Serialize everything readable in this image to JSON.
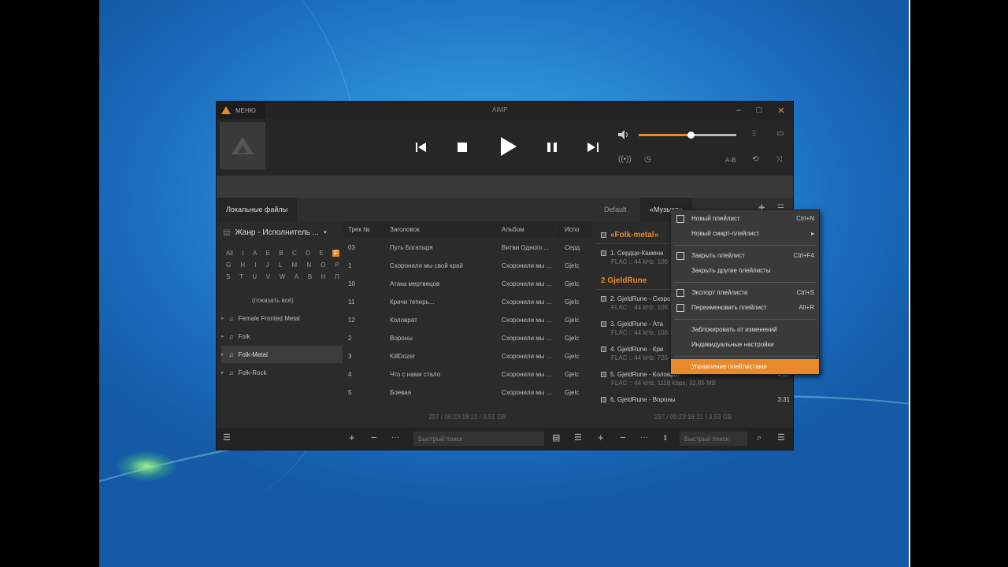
{
  "window": {
    "menu_label": "МЕНЮ",
    "title": "AIMP",
    "minimize": "–",
    "maximize": "□",
    "close": "✕"
  },
  "player": {
    "volume_percent": 53,
    "ab_label": "A-B"
  },
  "tabs": {
    "local": "Локальные файлы",
    "default": "Default",
    "music": "«Музыка»"
  },
  "library": {
    "grouping": "Жанр - Исполнитель ...",
    "alphabet_rows": [
      [
        "All",
        "I",
        "А",
        "Б",
        "В",
        "С",
        "D",
        "E"
      ],
      [
        "G",
        "H",
        "I",
        "J",
        "L",
        "M",
        "N",
        "O",
        "P"
      ],
      [
        "S",
        "T",
        "U",
        "V",
        "W",
        "A",
        "В",
        "H",
        "П"
      ]
    ],
    "selected_letter": "F",
    "show_all": "(показать всё)",
    "genres": [
      "Female Fronted Metal",
      "Folk",
      "Folk-Metal",
      "Folk-Rock"
    ]
  },
  "table": {
    "headers": [
      "Трек №",
      "Заголовок",
      "Альбом",
      "Испо"
    ],
    "rows": [
      [
        "03",
        "Путь Богатыря",
        "Витви Одного ...",
        "Серд"
      ],
      [
        "1",
        "Схоронили мы свой край",
        "Схоронили мы ...",
        "Gjelc"
      ],
      [
        "10",
        "Атака мертвецов",
        "Схоронили мы ...",
        "Gjelc"
      ],
      [
        "11",
        "Кричи теперь...",
        "Схоронили мы ...",
        "Gjelc"
      ],
      [
        "12",
        "Коловрат",
        "Схоронили мы ...",
        "Gjelc"
      ],
      [
        "2",
        "Вороны",
        "Схоронили мы ...",
        "Gjelc"
      ],
      [
        "3",
        "KillDozer",
        "Схоронили мы ...",
        "Gjelc"
      ],
      [
        "4",
        "Что с нами стало",
        "Схоронили мы ...",
        "Gjelc"
      ],
      [
        "5",
        "Боевая",
        "Схоронили мы ...",
        "Gjelc"
      ]
    ],
    "summary": "297 / 00:23:18:21 / 3,51 GB",
    "quick_search": "Быстрый поиск"
  },
  "playlist": {
    "group1": "«Folk-metal»",
    "group2": "2 GjeldRune",
    "items": [
      {
        "title": "1. Сердце-Каменн",
        "info": "FLAC :: 44 kHz, 106"
      },
      {
        "title": "2. GjeldRune - Скорон",
        "info": "FLAC :: 44 kHz, 106"
      },
      {
        "title": "3. GjeldRune - Ата",
        "info": "FLAC :: 44 kHz, 106"
      },
      {
        "title": "4. GjeldRune - Кри",
        "info": "FLAC :: 44 kHz, 726"
      },
      {
        "title": "5. GjeldRune - Коловрат",
        "info": "FLAC :: 44 kHz, 1118 kbps, 32,85 MB",
        "duration": "4:07"
      },
      {
        "title": "6. GjeldRune - Вороны",
        "info": "",
        "duration": "3:31"
      }
    ],
    "summary": "297 / 00:23:18:21 / 3,53 GB",
    "quick_search": "Быстрый поиск"
  },
  "context_menu": [
    {
      "label": "Новый плейлист",
      "shortcut": "Ctrl+N",
      "icon": "new-playlist-icon"
    },
    {
      "label": "Новый смарт-плейлист",
      "shortcut": "▸"
    },
    {
      "label": "Закрыть плейлист",
      "shortcut": "Ctrl+F4",
      "icon": "close-playlist-icon"
    },
    {
      "label": "Закрыть другие плейлисты",
      "shortcut": ""
    },
    {
      "label": "Экспорт плейлиста",
      "shortcut": "Ctrl+S",
      "icon": "export-icon"
    },
    {
      "label": "Переименовать плейлист",
      "shortcut": "Alt+R",
      "icon": "rename-icon"
    },
    {
      "label": "Заблокировать от изменений",
      "shortcut": ""
    },
    {
      "label": "Индивидуальные настройки",
      "shortcut": ""
    },
    {
      "label": "Управление плейлистами",
      "shortcut": ""
    }
  ],
  "colors": {
    "accent": "#e8892a",
    "background": "#2b2b2b"
  }
}
